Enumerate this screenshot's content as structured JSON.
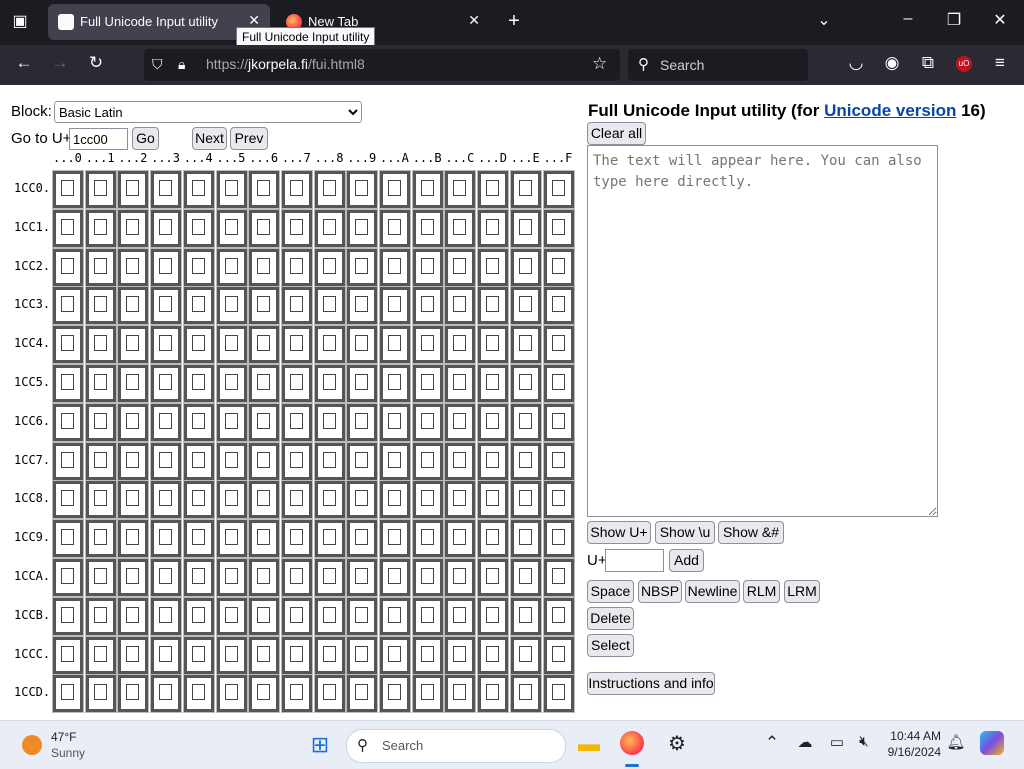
{
  "browser": {
    "tabs": [
      {
        "title": "Full Unicode Input utility",
        "active": true
      },
      {
        "title": "New Tab",
        "active": false
      }
    ],
    "tooltip": "Full Unicode Input utility",
    "url": {
      "prefix": "https://",
      "host": "jkorpela.fi",
      "path": "/fui.html8"
    },
    "search_placeholder": "Search"
  },
  "left": {
    "block_label": "Block:",
    "block_value": "Basic Latin",
    "goto_label": "Go to U+",
    "goto_value": "1cc00",
    "go_button": "Go",
    "next_button": "Next",
    "prev_button": "Prev",
    "column_headers": [
      "...0",
      "...1",
      "...2",
      "...3",
      "...4",
      "...5",
      "...6",
      "...7",
      "...8",
      "...9",
      "...A",
      "...B",
      "...C",
      "...D",
      "...E",
      "...F"
    ],
    "row_headers": [
      "1CC0.",
      "1CC1.",
      "1CC2.",
      "1CC3.",
      "1CC4.",
      "1CC5.",
      "1CC6.",
      "1CC7.",
      "1CC8.",
      "1CC9.",
      "1CCA.",
      "1CCB.",
      "1CCC.",
      "1CCD."
    ]
  },
  "right": {
    "title_prefix": "Full Unicode Input utility (for ",
    "title_link": "Unicode version",
    "title_suffix": " 16)",
    "clear_button": "Clear all",
    "textarea_placeholder": "The text will appear here. You can also type here directly.",
    "show_buttons": [
      "Show U+",
      "Show \\u",
      "Show &#"
    ],
    "uplus_label": "U+",
    "add_button": "Add",
    "insert_buttons": [
      "Space",
      "NBSP",
      "Newline",
      "RLM",
      "LRM"
    ],
    "delete_button": "Delete",
    "select_button": "Select",
    "instructions_button": "Instructions and info"
  },
  "taskbar": {
    "weather_temp": "47°F",
    "weather_desc": "Sunny",
    "search_label": "Search",
    "time": "10:44 AM",
    "date": "9/16/2024"
  },
  "colors": {
    "tabbar_bg": "#1c1b22",
    "navbar_bg": "#2b2a33",
    "link": "#0645ad"
  }
}
